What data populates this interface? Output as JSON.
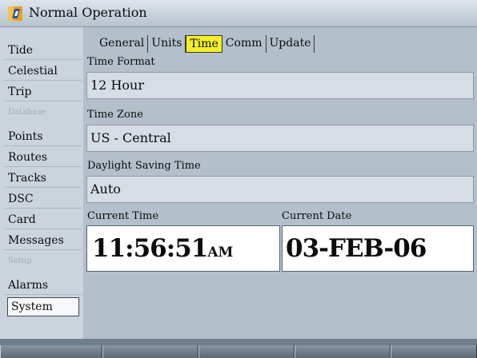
{
  "window": {
    "title": "Normal Operation",
    "icon": "garmin-gps-icon"
  },
  "sidebar": {
    "items": [
      {
        "label": "Tide",
        "kind": "item"
      },
      {
        "label": "Celestial",
        "kind": "item"
      },
      {
        "label": "Trip",
        "kind": "item"
      },
      {
        "label": "Database",
        "kind": "heading"
      },
      {
        "label": "Points",
        "kind": "item"
      },
      {
        "label": "Routes",
        "kind": "item"
      },
      {
        "label": "Tracks",
        "kind": "item"
      },
      {
        "label": "DSC",
        "kind": "item"
      },
      {
        "label": "Card",
        "kind": "item"
      },
      {
        "label": "Messages",
        "kind": "item"
      },
      {
        "label": "Setup",
        "kind": "heading"
      },
      {
        "label": "Alarms",
        "kind": "item"
      },
      {
        "label": "System",
        "kind": "item",
        "selected": true
      }
    ]
  },
  "tabs": [
    {
      "label": "General"
    },
    {
      "label": "Units"
    },
    {
      "label": "Time",
      "active": true
    },
    {
      "label": "Comm"
    },
    {
      "label": "Update"
    }
  ],
  "fields": {
    "time_format": {
      "label": "Time Format",
      "value": "12 Hour"
    },
    "time_zone": {
      "label": "Time Zone",
      "value": "US - Central"
    },
    "daylight_saving": {
      "label": "Daylight Saving Time",
      "value": "Auto"
    }
  },
  "current_time": {
    "label": "Current Time",
    "value": "11:56:51",
    "suffix": "AM"
  },
  "current_date": {
    "label": "Current Date",
    "value": "03-FEB-06"
  },
  "softkeys": [
    "",
    "",
    "",
    "",
    ""
  ],
  "colors": {
    "highlight": "#f3ef29",
    "panel": "#b3bfcb",
    "field": "#d6dde5"
  }
}
